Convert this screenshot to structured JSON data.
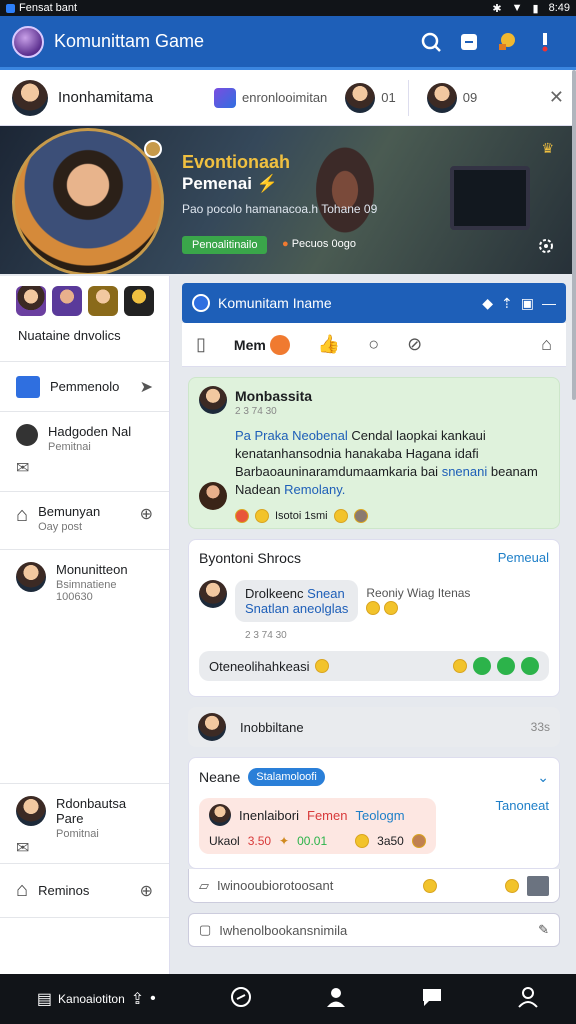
{
  "status_bar": {
    "app": "Fensat bant",
    "time": "8:49"
  },
  "app_bar": {
    "title": "Komunittam Game"
  },
  "profile_row": {
    "name": "Inonhamitama",
    "chip1": "enronlooimitan",
    "chip2_value": "01",
    "chip3_value": "09"
  },
  "banner": {
    "title": "Evontionaah",
    "subtitle": "Pemenai",
    "description": "Pao pocolo hamanacoa.h Tohane 09",
    "button": "Penoalitinailo",
    "link": "Pecuos 0ogo"
  },
  "left": {
    "section_title": "Nuataine dnvolics",
    "items": [
      {
        "title": "Pemmenolo",
        "sub": ""
      },
      {
        "title": "Hadgoden Nal",
        "sub": "Pemitnai"
      },
      {
        "title": "Bemunyan",
        "sub": "Oay post"
      },
      {
        "title": "Monunitteon",
        "sub": "Bsimnatiene 100630"
      },
      {
        "title": "Rdonbautsa Pare",
        "sub": "Pomitnai"
      },
      {
        "title": "Reminos",
        "sub": ""
      }
    ]
  },
  "group_bar": {
    "title": "Komunitam Iname"
  },
  "tabs": {
    "active": "Mem"
  },
  "post": {
    "author": "Monbassita",
    "time": "2 3 74 30",
    "body_blue": "Pa Praka Neobenal",
    "body_text": "Cendal laopkai kankaui kenatanhansodnia hanakaba Hagana idafi Barbaoauninaramdumaamkaria bai",
    "body_blue2": "snenani",
    "body_tail": "beanam Nadean",
    "body_blue3": "Remolany.",
    "reaction_text": "Isotoi 1smi"
  },
  "section": {
    "title": "Byontoni Shrocs",
    "action": "Pemeual",
    "bubble_line1": "Drolkeenc",
    "bubble_blue1": "Snean",
    "bubble_line2": "Snatlan aneolglas",
    "side_text": "Reoniy Wiag Itenas",
    "time": "2 3 74 30",
    "reply": "Oteneolihahkeasi"
  },
  "comment": {
    "text": "Inobbiltane",
    "count": "33s"
  },
  "neane": {
    "title": "Neane",
    "pill": "Stalamoloofi",
    "name": "Inenlaibori",
    "name_red": "Femen",
    "name_blue": "Teologm",
    "action": "Tanoneat",
    "stats_left": "Ukaol",
    "stats_red": "3.50",
    "stats_green": "00.01",
    "stats_right": "3a50"
  },
  "composer1": {
    "placeholder": "Iwinooubiorotoosant"
  },
  "composer2": {
    "placeholder": "Iwhenolbookansnimila"
  },
  "bottom_nav": {
    "label": "Kanoaiotiton"
  }
}
